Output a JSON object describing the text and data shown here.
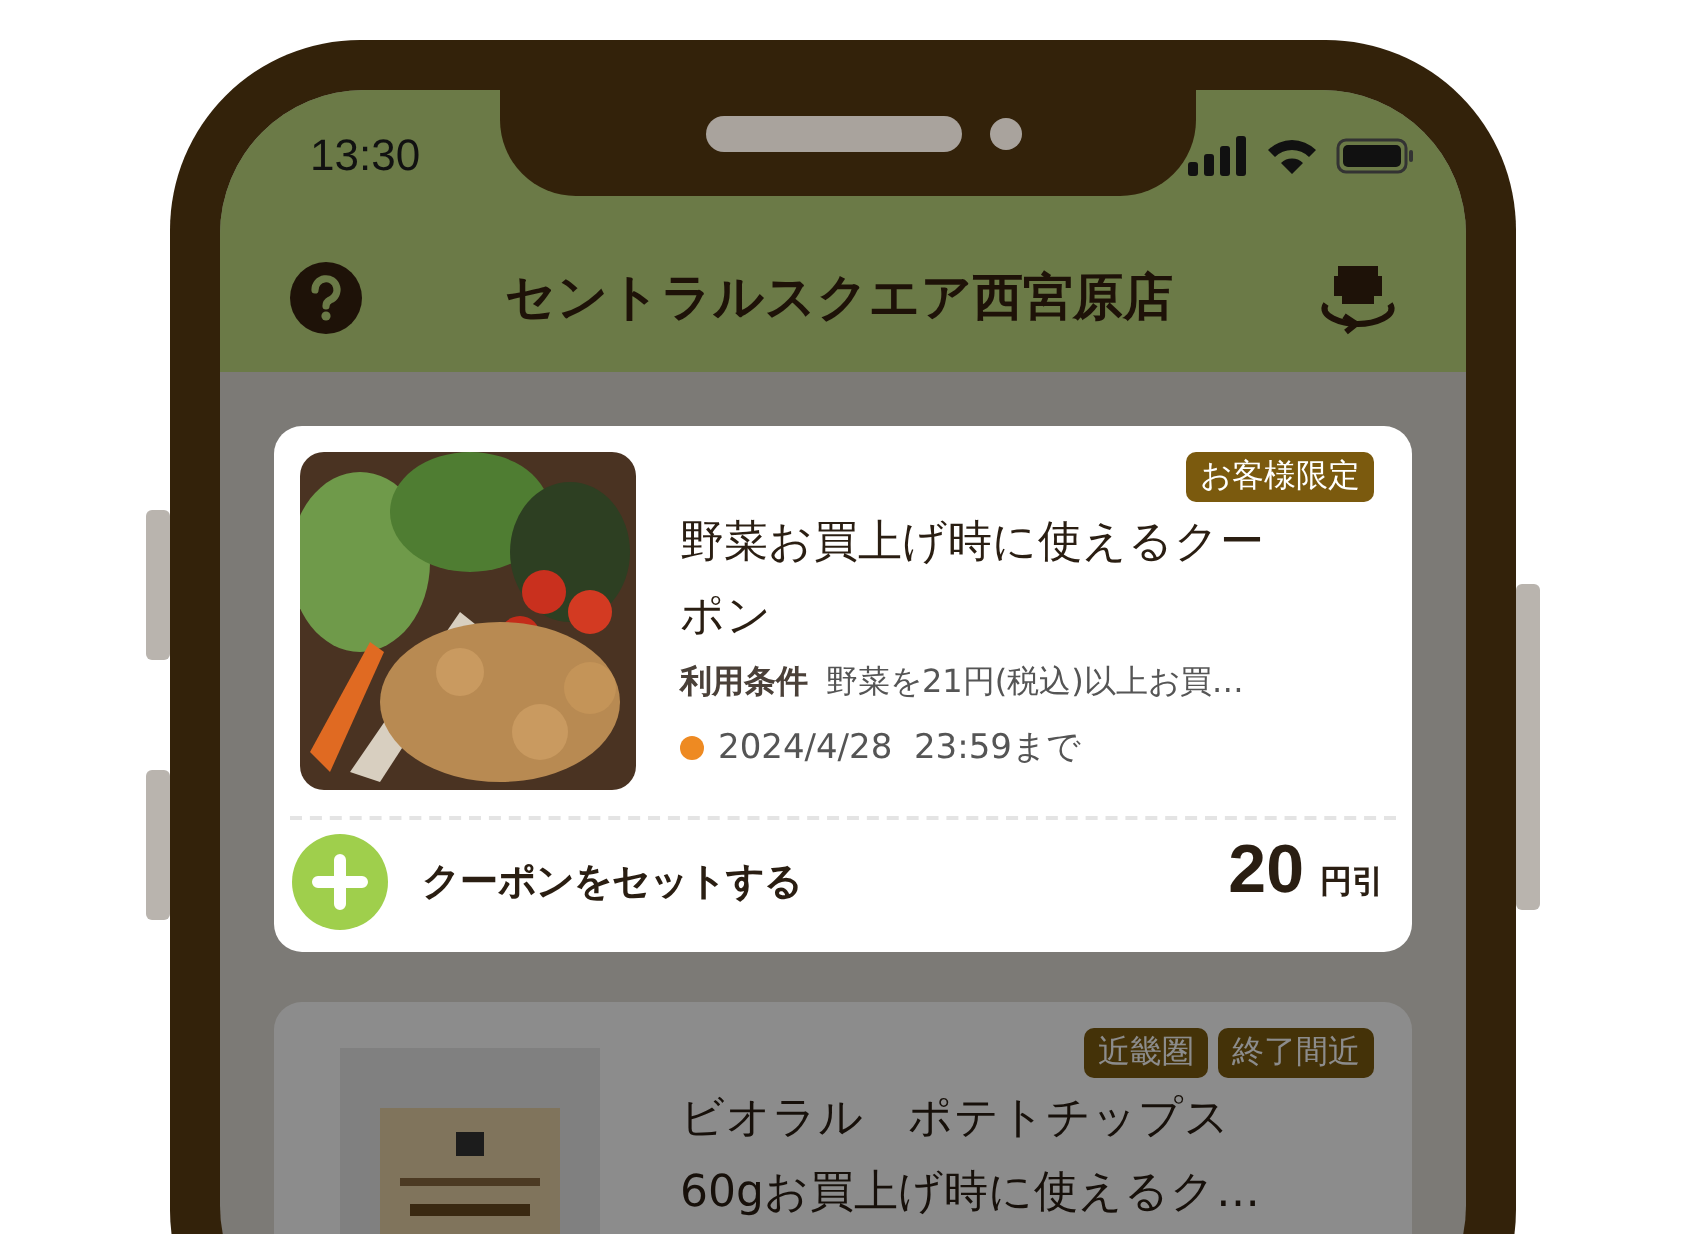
{
  "status_bar": {
    "time": "13:30"
  },
  "header": {
    "title": "セントラルスクエア西宮原店"
  },
  "coupons": [
    {
      "highlighted": true,
      "badges": [
        "お客様限定"
      ],
      "title_lines": [
        "野菜お買上げ時に使えるクー",
        "ポン"
      ],
      "conditions_label": "利用条件",
      "conditions": "野菜を21円(税込)以上お買…",
      "expiry": "2024/4/28  23:59まで",
      "action": "クーポンをセットする",
      "discount": "20",
      "discount_unit": "円引"
    },
    {
      "highlighted": false,
      "badges": [
        "近畿圏",
        "終了間近"
      ],
      "title_lines": [
        "ビオラル　ポテトチップス",
        "60gお買上げ時に使えるク…"
      ]
    }
  ]
}
